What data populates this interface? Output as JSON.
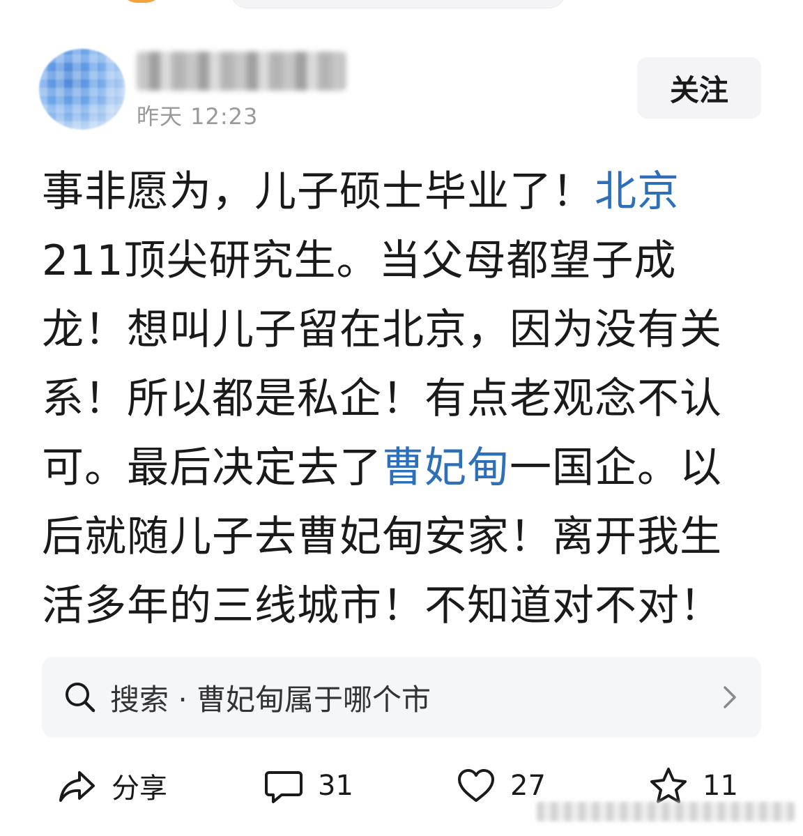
{
  "post": {
    "time": "昨天  12:23",
    "follow_label": "关注",
    "body": {
      "line1_a": "事非愿为，儿子硕士毕业了！",
      "line1_link": "北京",
      "line2": "211顶尖研究生。当父母都望子成",
      "line3": "龙！想叫儿子留在北京，因为没有关",
      "line4": "系！所以都是私企！有点老观念不认",
      "line5_a": "可。最后决定去了",
      "line5_link": "曹妃甸",
      "line5_b": "一国企。以",
      "line6": "后就随儿子去曹妃甸安家！离开我生",
      "line7": "活多年的三线城市！不知道对不对！"
    }
  },
  "search_suggestion": {
    "text": "搜索 · 曹妃甸属于哪个市"
  },
  "actions": {
    "share_label": "分享",
    "comment_count": "31",
    "like_count": "27",
    "favorite_count": "11"
  },
  "icons": {
    "search": "search-icon",
    "chevron": "chevron-right-icon",
    "share": "share-icon",
    "comment": "comment-icon",
    "like": "heart-icon",
    "favorite": "star-icon"
  },
  "colors": {
    "link": "#2e6fba",
    "time": "#999999",
    "button_bg": "#f4f4f6"
  }
}
